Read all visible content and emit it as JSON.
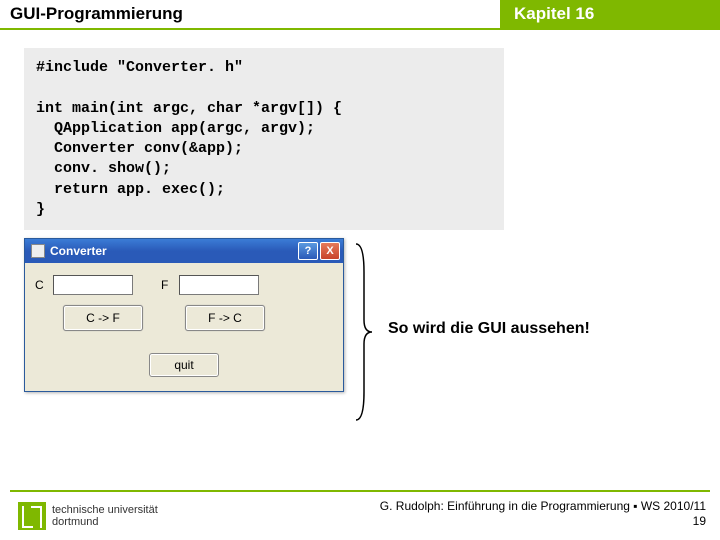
{
  "header": {
    "left": "GUI-Programmierung",
    "right": "Kapitel 16"
  },
  "code": "#include \"Converter. h\"\n\nint main(int argc, char *argv[]) {\n  QApplication app(argc, argv);\n  Converter conv(&app);\n  conv. show();\n  return app. exec();\n}",
  "window": {
    "title": "Converter",
    "help": "?",
    "close": "X",
    "label_c": "C",
    "label_f": "F",
    "btn_c2f": "C -> F",
    "btn_f2c": "F -> C",
    "btn_quit": "quit"
  },
  "caption": "So wird die GUI aussehen!",
  "logo": {
    "line1": "technische universität",
    "line2": "dortmund"
  },
  "credits": {
    "line1": "G. Rudolph: Einführung in die Programmierung ▪ WS 2010/11",
    "line2": "19"
  }
}
